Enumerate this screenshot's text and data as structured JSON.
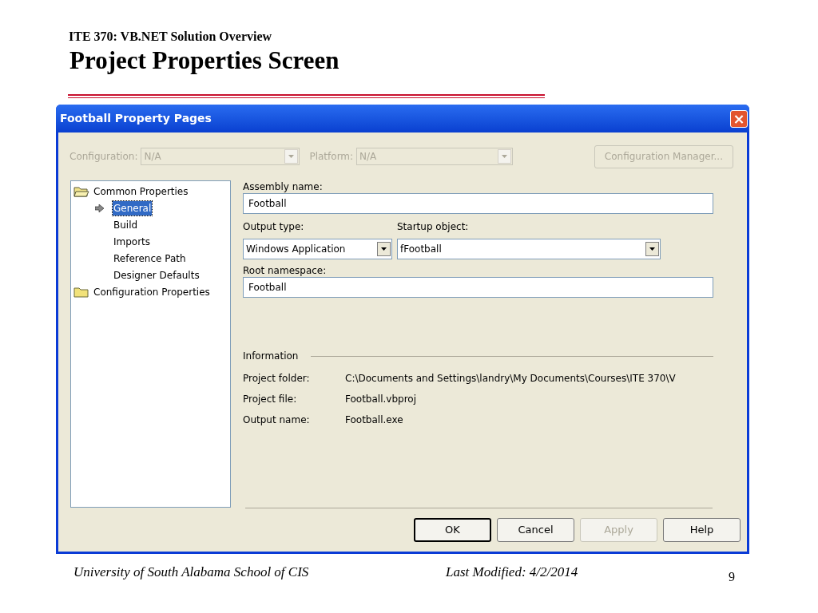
{
  "slide": {
    "header": "ITE 370: VB.NET Solution Overview",
    "title": "Project Properties Screen",
    "footer_left": "University of South Alabama School of CIS",
    "footer_center": "Last Modified: 4/2/2014",
    "page_number": "9"
  },
  "window": {
    "title": "Football Property Pages",
    "close": "×"
  },
  "top_bar": {
    "configuration": {
      "label": "Configuration:",
      "value": "N/A",
      "disabled": true
    },
    "platform": {
      "label": "Platform:",
      "value": "N/A",
      "disabled": true
    },
    "manager_button": {
      "label": "Configuration Manager...",
      "disabled": true
    }
  },
  "tree": [
    {
      "label": "Common Properties",
      "expanded": true,
      "selected": false,
      "children": [
        {
          "label": "General",
          "selected": true
        },
        {
          "label": "Build",
          "selected": false
        },
        {
          "label": "Imports",
          "selected": false
        },
        {
          "label": "Reference Path",
          "selected": false
        },
        {
          "label": "Designer Defaults",
          "selected": false
        }
      ]
    },
    {
      "label": "Configuration Properties",
      "expanded": false,
      "selected": false
    }
  ],
  "form": {
    "assembly_name": {
      "label": "Assembly name:",
      "value": "Football"
    },
    "output_type": {
      "label": "Output type:",
      "value": "Windows Application"
    },
    "startup_object": {
      "label": "Startup object:",
      "value": "fFootball"
    },
    "root_namespace": {
      "label": "Root namespace:",
      "value": "Football"
    }
  },
  "information": {
    "heading": "Information",
    "rows": [
      {
        "label": "Project folder:",
        "value": "C:\\Documents and Settings\\landry\\My Documents\\Courses\\ITE 370\\V"
      },
      {
        "label": "Project file:",
        "value": "Football.vbproj"
      },
      {
        "label": "Output name:",
        "value": "Football.exe"
      }
    ]
  },
  "buttons": [
    {
      "label": "OK",
      "default": true,
      "disabled": false
    },
    {
      "label": "Cancel",
      "default": false,
      "disabled": false
    },
    {
      "label": "Apply",
      "default": false,
      "disabled": true
    },
    {
      "label": "Help",
      "default": false,
      "disabled": false
    }
  ]
}
